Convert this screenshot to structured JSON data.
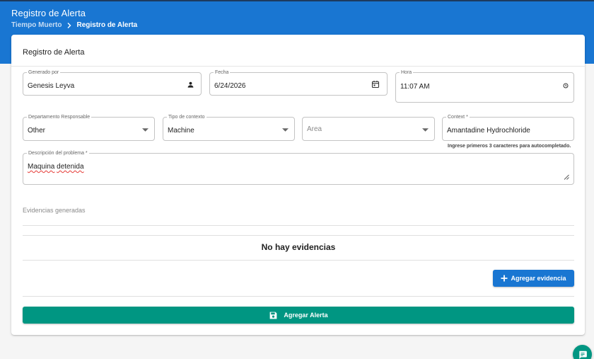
{
  "header": {
    "title": "Registro de Alerta",
    "breadcrumb": {
      "parent": "Tiempo Muerto",
      "current": "Registro de Alerta"
    }
  },
  "card": {
    "title": "Registro de Alerta"
  },
  "form": {
    "generated_by": {
      "label": "Generado por",
      "value": "Genesis Leyva",
      "icon": "person-icon"
    },
    "date": {
      "label": "Fecha",
      "value": "6/24/2026",
      "icon": "calendar-icon"
    },
    "time": {
      "label": "Hora",
      "hour": "11",
      "minute": "07",
      "period": "AM",
      "icon": "clock-icon"
    },
    "department": {
      "label": "Departamento Responsable",
      "value": "Other",
      "icon": "dropdown-arrow-icon"
    },
    "context_type": {
      "label": "Tipo de contexto",
      "value": "Machine",
      "icon": "dropdown-arrow-icon"
    },
    "area": {
      "placeholder": "Area",
      "icon": "dropdown-arrow-icon"
    },
    "context": {
      "label": "Context *",
      "value": "Amantadine Hydrochloride",
      "helper": "Ingrese primeros 3 caracteres para autocompletado."
    },
    "description": {
      "label": "Descripción del problema *",
      "value_word1": "Maquina",
      "value_word2": "detenida"
    }
  },
  "evidence": {
    "section_label": "Evidencias generadas",
    "empty_text": "No hay evidencias",
    "add_button": "Agregar evidencia"
  },
  "submit": {
    "label": "Agregar Alerta",
    "icon": "save-icon"
  },
  "fab": {
    "icon": "chat-icon"
  },
  "colors": {
    "primary": "#1976d2",
    "success": "#009682",
    "header_border": "#1d3a5e"
  }
}
